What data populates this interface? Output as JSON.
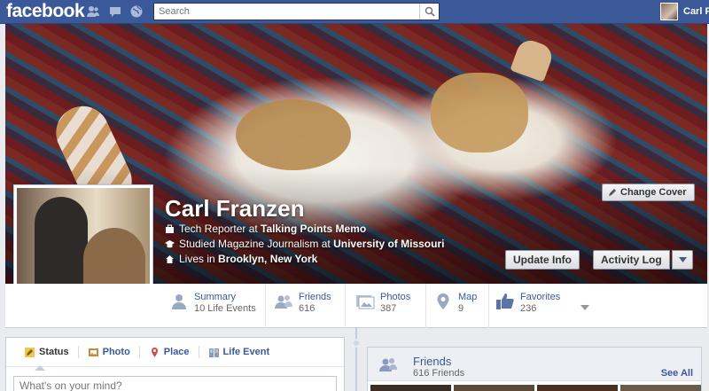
{
  "topbar": {
    "logo": "facebook",
    "search_placeholder": "Search",
    "user_name": "Carl Franzen",
    "icons": [
      "friend-requests-icon",
      "messages-icon",
      "notifications-globe-icon",
      "search-icon"
    ]
  },
  "cover": {
    "change_cover_label": "Change Cover"
  },
  "profile": {
    "name": "Carl Franzen",
    "info": [
      {
        "icon": "work-briefcase-icon",
        "prefix": "Tech Reporter at ",
        "bold": "Talking Points Memo"
      },
      {
        "icon": "education-cap-icon",
        "prefix": "Studied Magazine Journalism at ",
        "bold": "University of Missouri"
      },
      {
        "icon": "home-icon",
        "prefix": "Lives in ",
        "bold": "Brooklyn, New York"
      }
    ],
    "update_info_label": "Update Info",
    "activity_log_label": "Activity Log"
  },
  "nav": [
    {
      "icon": "person-icon",
      "title": "Summary",
      "sub": "10 Life Events"
    },
    {
      "icon": "friends-icon",
      "title": "Friends",
      "sub": "616"
    },
    {
      "icon": "photos-icon",
      "title": "Photos",
      "sub": "387"
    },
    {
      "icon": "map-pin-icon",
      "title": "Map",
      "sub": "9"
    },
    {
      "icon": "like-thumb-icon",
      "title": "Favorites",
      "sub": "236"
    }
  ],
  "composer": {
    "tabs": [
      {
        "icon": "status-pencil-icon",
        "label": "Status"
      },
      {
        "icon": "photo-icon",
        "label": "Photo"
      },
      {
        "icon": "place-pin-icon",
        "label": "Place"
      },
      {
        "icon": "life-event-book-icon",
        "label": "Life Event"
      }
    ],
    "placeholder": "What's on your mind?"
  },
  "friends_box": {
    "title": "Friends",
    "count": "616 Friends",
    "see_all": "See All"
  },
  "colors": {
    "brand": "#3b5998",
    "link": "#3b5998",
    "background": "#e9ebee"
  }
}
